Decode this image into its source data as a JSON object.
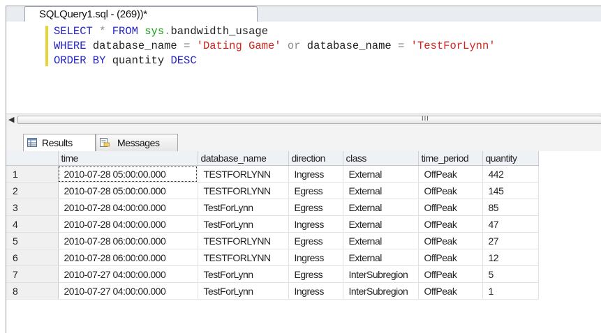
{
  "document_tab": {
    "title": "SQLQuery1.sql - (269))*"
  },
  "editor": {
    "lines": [
      [
        {
          "t": "SELECT ",
          "c": "kw"
        },
        {
          "t": "* ",
          "c": "gray"
        },
        {
          "t": "FROM ",
          "c": "kw"
        },
        {
          "t": "sys",
          "c": "fn"
        },
        {
          "t": ".",
          "c": "gray"
        },
        {
          "t": "bandwidth_usage",
          "c": ""
        }
      ],
      [
        {
          "t": "WHERE ",
          "c": "kw"
        },
        {
          "t": "database_name ",
          "c": ""
        },
        {
          "t": "= ",
          "c": "gray"
        },
        {
          "t": "'Dating Game' ",
          "c": "str"
        },
        {
          "t": "or ",
          "c": "gray"
        },
        {
          "t": "database_name ",
          "c": ""
        },
        {
          "t": "= ",
          "c": "gray"
        },
        {
          "t": "'TestForLynn'",
          "c": "str"
        }
      ],
      [
        {
          "t": "ORDER BY ",
          "c": "kw"
        },
        {
          "t": "quantity ",
          "c": ""
        },
        {
          "t": "DESC",
          "c": "kw"
        }
      ]
    ]
  },
  "scrollbar": {
    "grip": "III"
  },
  "results_tabs": [
    {
      "label": "Results",
      "icon": "grid-icon",
      "active": true
    },
    {
      "label": "Messages",
      "icon": "messages-icon",
      "active": false
    }
  ],
  "grid": {
    "columns": [
      "time",
      "database_name",
      "direction",
      "class",
      "time_period",
      "quantity"
    ],
    "rows": [
      [
        "1",
        "2010-07-28 05:00:00.000",
        "TESTFORLYNN",
        "Ingress",
        "External",
        "OffPeak",
        "442"
      ],
      [
        "2",
        "2010-07-28 05:00:00.000",
        "TESTFORLYNN",
        "Egress",
        "External",
        "OffPeak",
        "145"
      ],
      [
        "3",
        "2010-07-28 04:00:00.000",
        "TestForLynn",
        "Egress",
        "External",
        "OffPeak",
        "85"
      ],
      [
        "4",
        "2010-07-28 04:00:00.000",
        "TestForLynn",
        "Ingress",
        "External",
        "OffPeak",
        "47"
      ],
      [
        "5",
        "2010-07-28 06:00:00.000",
        "TESTFORLYNN",
        "Egress",
        "External",
        "OffPeak",
        "27"
      ],
      [
        "6",
        "2010-07-28 06:00:00.000",
        "TESTFORLYNN",
        "Ingress",
        "External",
        "OffPeak",
        "12"
      ],
      [
        "7",
        "2010-07-27 04:00:00.000",
        "TestForLynn",
        "Egress",
        "InterSubregion",
        "OffPeak",
        "5"
      ],
      [
        "8",
        "2010-07-27 04:00:00.000",
        "TestForLynn",
        "Ingress",
        "InterSubregion",
        "OffPeak",
        "1"
      ]
    ]
  },
  "colors": {
    "keyword": "#2424c8",
    "system_object": "#18a018",
    "string_literal": "#d0241c",
    "operator": "#8a8a8a",
    "change_marker": "#e6d43a"
  }
}
